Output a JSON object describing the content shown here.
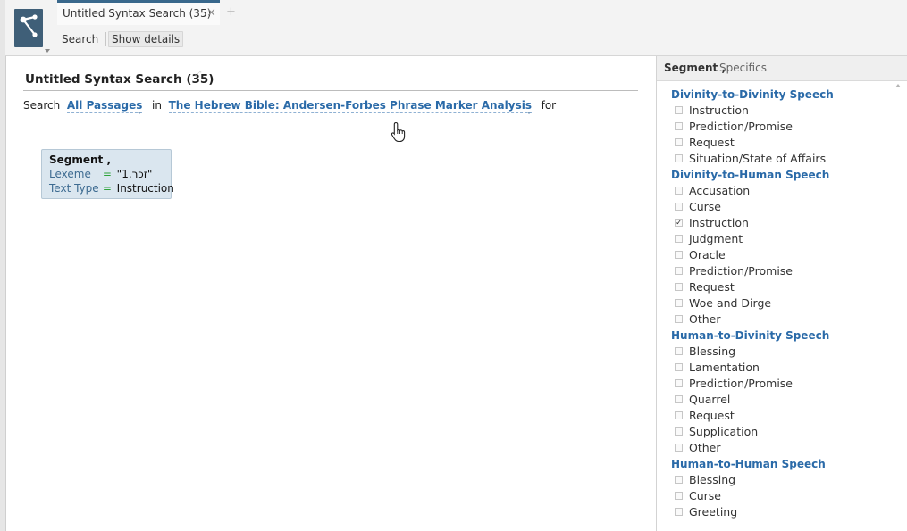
{
  "tab": {
    "title": "Untitled Syntax Search (35)",
    "close": "×",
    "new": "+"
  },
  "toolbar": {
    "search_label": "Search",
    "details_label": "Show details"
  },
  "search": {
    "title": "Untitled Syntax Search (35)",
    "prefix": "Search",
    "passages": "All Passages",
    "in": "in",
    "resource": "The Hebrew Bible: Andersen-Forbes Phrase Marker Analysis",
    "for": "for"
  },
  "segment": {
    "title": "Segment ,",
    "rows": [
      {
        "key": "Lexeme",
        "eq": "=",
        "value": "\"זכר.1\""
      },
      {
        "key": "Text Type",
        "eq": "=",
        "value": "Instruction"
      }
    ]
  },
  "panel": {
    "header_segment": "Segment ,",
    "header_specifics": "Specifics",
    "groups": [
      {
        "title": "Divinity-to-Divinity Speech",
        "options": [
          {
            "label": "Instruction",
            "checked": false
          },
          {
            "label": "Prediction/Promise",
            "checked": false
          },
          {
            "label": "Request",
            "checked": false
          },
          {
            "label": "Situation/State of Affairs",
            "checked": false
          }
        ]
      },
      {
        "title": "Divinity-to-Human Speech",
        "options": [
          {
            "label": "Accusation",
            "checked": false
          },
          {
            "label": "Curse",
            "checked": false
          },
          {
            "label": "Instruction",
            "checked": true
          },
          {
            "label": "Judgment",
            "checked": false
          },
          {
            "label": "Oracle",
            "checked": false
          },
          {
            "label": "Prediction/Promise",
            "checked": false
          },
          {
            "label": "Request",
            "checked": false
          },
          {
            "label": "Woe and Dirge",
            "checked": false
          },
          {
            "label": "Other",
            "checked": false
          }
        ]
      },
      {
        "title": "Human-to-Divinity Speech",
        "options": [
          {
            "label": "Blessing",
            "checked": false
          },
          {
            "label": "Lamentation",
            "checked": false
          },
          {
            "label": "Prediction/Promise",
            "checked": false
          },
          {
            "label": "Quarrel",
            "checked": false
          },
          {
            "label": "Request",
            "checked": false
          },
          {
            "label": "Supplication",
            "checked": false
          },
          {
            "label": "Other",
            "checked": false
          }
        ]
      },
      {
        "title": "Human-to-Human Speech",
        "options": [
          {
            "label": "Blessing",
            "checked": false
          },
          {
            "label": "Curse",
            "checked": false
          },
          {
            "label": "Greeting",
            "checked": false
          }
        ]
      }
    ]
  },
  "icons": {
    "app": "syntax-search-icon",
    "cursor": "hand-pointer-icon",
    "edit": "expand-icon"
  },
  "colors": {
    "accent": "#2a6aa8",
    "app_icon": "#3f5f78",
    "segment_box": "#dae6ef"
  }
}
